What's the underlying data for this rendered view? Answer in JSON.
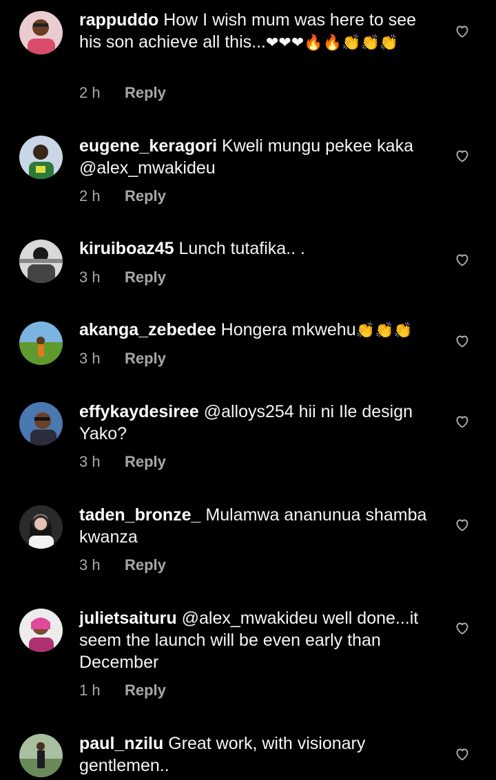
{
  "comments": [
    {
      "username": "rappuddo",
      "text": "How I wish mum was here to see his son achieve all this...",
      "emoji": "❤❤❤🔥🔥👏👏👏",
      "time": "2 h",
      "reply": "Reply"
    },
    {
      "username": "eugene_keragori",
      "text": "Kweli mungu pekee kaka @alex_mwakideu",
      "time": "2 h",
      "reply": "Reply"
    },
    {
      "username": "kiruiboaz45",
      "text": "Lunch tutafika.. .",
      "time": "3 h",
      "reply": "Reply"
    },
    {
      "username": "akanga_zebedee",
      "text": "Hongera mkwehu",
      "emoji": "👏👏👏",
      "time": "3 h",
      "reply": "Reply"
    },
    {
      "username": "effykaydesiree",
      "text": "@alloys254 hii ni Ile design Yako?",
      "time": "3 h",
      "reply": "Reply"
    },
    {
      "username": "taden_bronze_",
      "text": "Mulamwa ananunua shamba kwanza",
      "time": "3 h",
      "reply": "Reply"
    },
    {
      "username": "julietsaituru",
      "text": "@alex_mwakideu well done...it seem the launch will be even early than December",
      "time": "1 h",
      "reply": "Reply"
    },
    {
      "username": "paul_nzilu",
      "text": "Great work, with visionary gentlemen..",
      "time": "",
      "reply": ""
    }
  ],
  "icons": {
    "like": "heart-outline-icon"
  },
  "colors": {
    "background": "#000000",
    "secondary_text": "#a8a8a8"
  }
}
